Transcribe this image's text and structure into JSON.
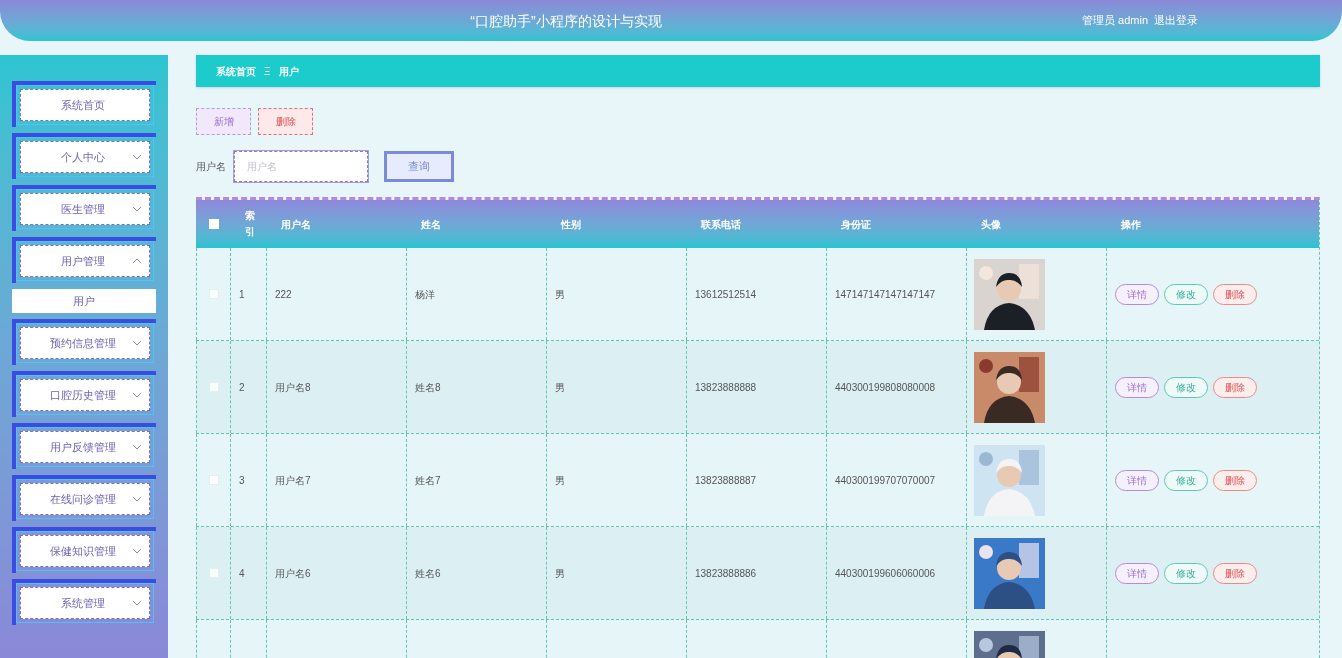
{
  "header": {
    "title": "“口腔助手”小程序的设计与实现",
    "user": "管理员 admin",
    "logout": "退出登录"
  },
  "sidebar": {
    "items": [
      {
        "label": "系统首页",
        "kind": "link"
      },
      {
        "label": "个人中心",
        "kind": "menu",
        "expanded": false
      },
      {
        "label": "医生管理",
        "kind": "menu",
        "expanded": false
      },
      {
        "label": "用户管理",
        "kind": "menu",
        "expanded": true,
        "children": [
          {
            "label": "用户"
          }
        ]
      },
      {
        "label": "预约信息管理",
        "kind": "menu",
        "expanded": false
      },
      {
        "label": "口腔历史管理",
        "kind": "menu",
        "expanded": false
      },
      {
        "label": "用户反馈管理",
        "kind": "menu",
        "expanded": false
      },
      {
        "label": "在线问诊管理",
        "kind": "menu",
        "expanded": false
      },
      {
        "label": "保健知识管理",
        "kind": "menu",
        "expanded": false
      },
      {
        "label": "系统管理",
        "kind": "menu",
        "expanded": false
      }
    ]
  },
  "breadcrumb": {
    "items": [
      "系统首页",
      "用户"
    ],
    "separator": "Ξ"
  },
  "toolbar": {
    "buttons": [
      {
        "label": "新增",
        "kind": "add"
      },
      {
        "label": "删除",
        "kind": "delete"
      }
    ]
  },
  "search": {
    "label": "用户名",
    "placeholder": "用户名",
    "button": "查询"
  },
  "table": {
    "header_checkbox": {
      "checked": false
    },
    "columns": [
      "索引",
      "用户名",
      "姓名",
      "性别",
      "联系电话",
      "身份证",
      "头像",
      "操作"
    ],
    "rows": [
      {
        "checked": false,
        "cells": [
          "1",
          "222",
          "杨洋",
          "男",
          "13612512514",
          "147147147147147147"
        ],
        "avatar": {
          "kind": "picture"
        },
        "actions": [
          "详情",
          "修改",
          "删除"
        ]
      },
      {
        "checked": false,
        "cells": [
          "2",
          "用户名8",
          "姓名8",
          "男",
          "13823888888",
          "440300199808080008"
        ],
        "avatar": {
          "kind": "picture"
        },
        "actions": [
          "详情",
          "修改",
          "删除"
        ]
      },
      {
        "checked": false,
        "cells": [
          "3",
          "用户名7",
          "姓名7",
          "男",
          "13823888887",
          "440300199707070007"
        ],
        "avatar": {
          "kind": "picture"
        },
        "actions": [
          "详情",
          "修改",
          "删除"
        ]
      },
      {
        "checked": false,
        "cells": [
          "4",
          "用户名6",
          "姓名6",
          "男",
          "13823888886",
          "440300199606060006"
        ],
        "avatar": {
          "kind": "picture"
        },
        "actions": [
          "详情",
          "修改",
          "删除"
        ]
      },
      {
        "cells": [],
        "avatar": {
          "kind": "picture"
        },
        "actions": []
      }
    ]
  }
}
